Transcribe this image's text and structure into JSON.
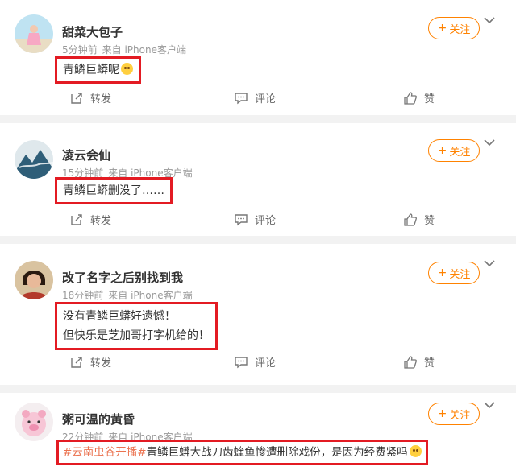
{
  "colors": {
    "accent": "#ff8200",
    "highlight_border": "#e31b23",
    "hashtag": "#eb7350",
    "background": "#f2f2f2"
  },
  "labels": {
    "follow": "关注",
    "repost": "转发",
    "comment": "评论",
    "like": "赞"
  },
  "posts": [
    {
      "username": "甜菜大包子",
      "time": "5分钟前",
      "source": "来自 iPhone客户端",
      "lines": [
        "青鳞巨蟒呢"
      ],
      "avatar_icon": "avatar-beach-icon"
    },
    {
      "username": "凌云会仙",
      "time": "15分钟前",
      "source": "来自 iPhone客户端",
      "lines": [
        "青鳞巨蟒删没了……"
      ],
      "avatar_icon": "avatar-mountain-icon"
    },
    {
      "username": "改了名字之后别找到我",
      "time": "18分钟前",
      "source": "来自 iPhone客户端",
      "lines": [
        "没有青鳞巨蟒好遗憾！",
        "但快乐是芝加哥打字机给的！"
      ],
      "avatar_icon": "avatar-person-icon"
    },
    {
      "username": "粥可温的黄昏",
      "time": "22分钟前",
      "source": "来自 iPhone客户端",
      "hashtag": "#云南虫谷开播#",
      "lines": [
        "青鳞巨蟒大战刀齿蝰鱼惨遭删除戏份，是因为经费紧吗"
      ],
      "avatar_icon": "avatar-pig-icon"
    }
  ]
}
